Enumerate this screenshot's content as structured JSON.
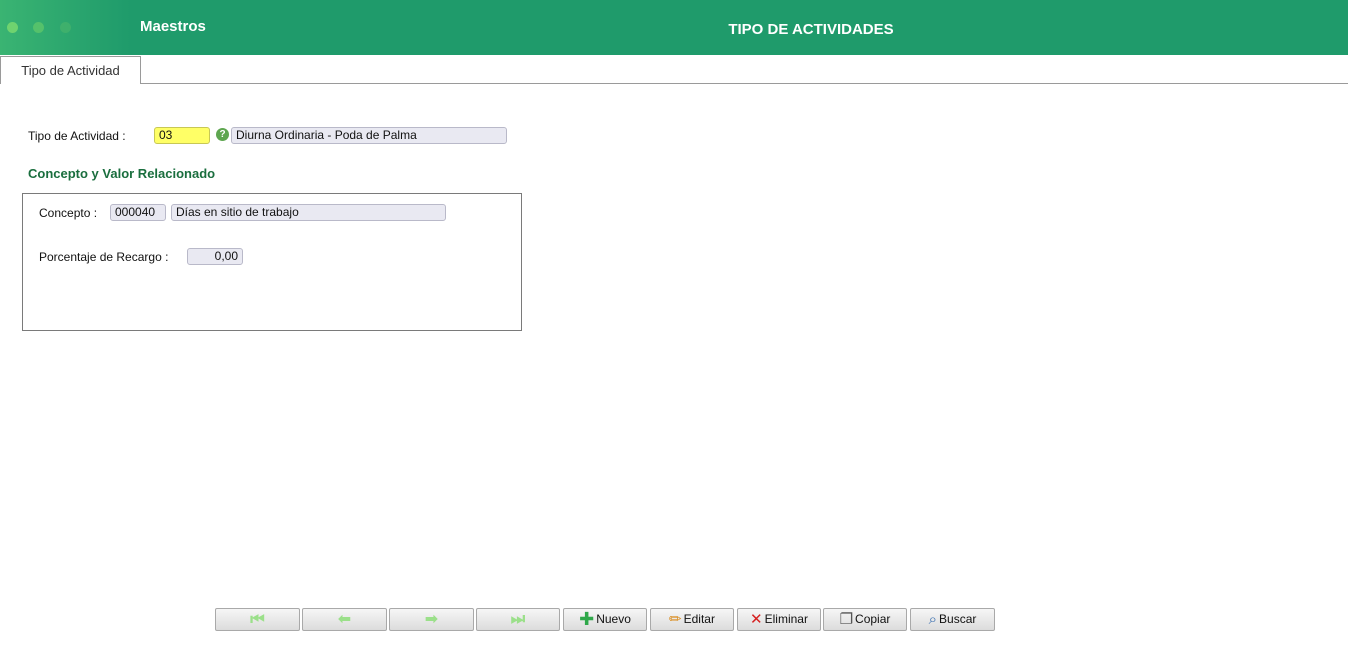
{
  "header": {
    "module": "Maestros",
    "title": "TIPO DE ACTIVIDADES"
  },
  "tabs": [
    {
      "label": "Tipo de Actividad",
      "active": true
    }
  ],
  "form": {
    "tipo_actividad_label": "Tipo de Actividad :",
    "tipo_actividad_code": "03",
    "tipo_actividad_desc": "Diurna Ordinaria - Poda de Palma",
    "help_icon": "?",
    "section_title": "Concepto y Valor Relacionado",
    "concepto_label": "Concepto :",
    "concepto_code": "000040",
    "concepto_desc": "Días en sitio de trabajo",
    "porcentaje_label": "Porcentaje de Recargo :",
    "porcentaje_value": "0,00"
  },
  "toolbar": {
    "first_icon": "first-record-icon",
    "prev_icon": "previous-record-icon",
    "next_icon": "next-record-icon",
    "last_icon": "last-record-icon",
    "nuevo": "Nuevo",
    "editar": "Editar",
    "eliminar": "Eliminar",
    "copiar": "Copiar",
    "buscar": "Buscar"
  },
  "colors": {
    "header_bg": "#1f9b6b",
    "section_title": "#1a6e3e",
    "code_field_bg": "#ffff66"
  }
}
